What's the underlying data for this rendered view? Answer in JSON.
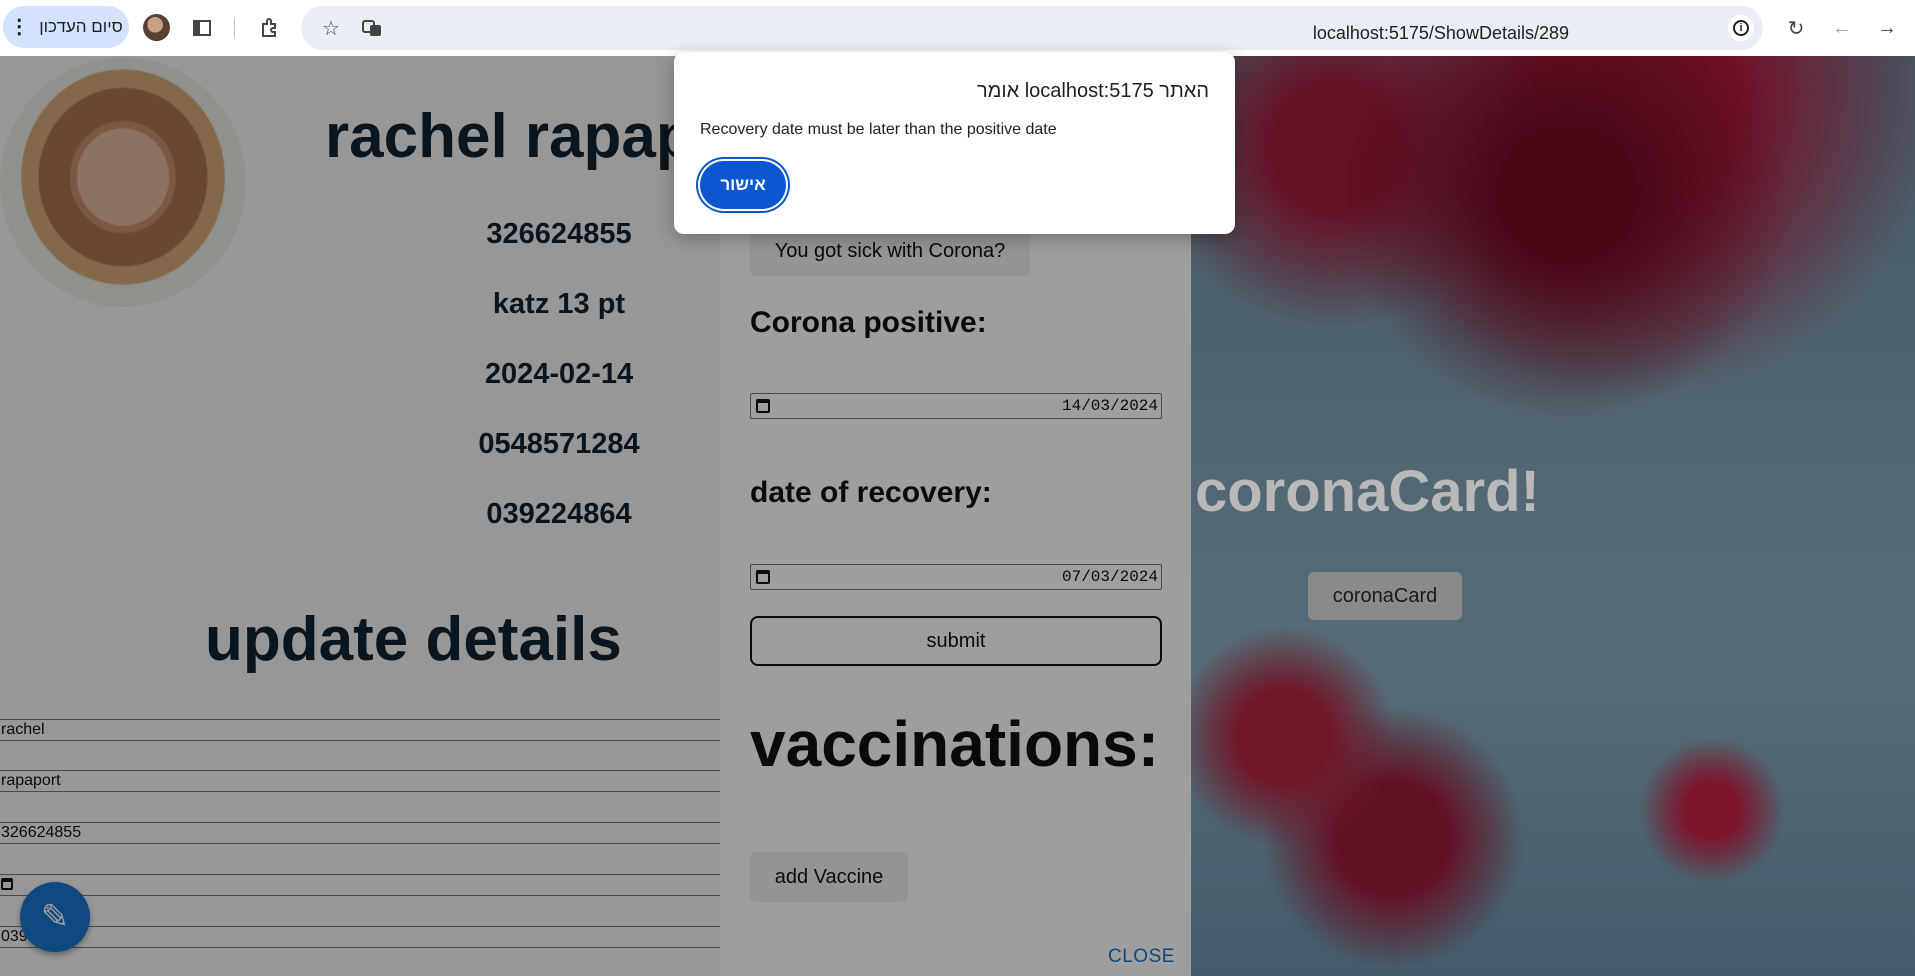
{
  "browser": {
    "update_button_label": "סיום העדכון",
    "url": "localhost:5175/ShowDetails/289",
    "icons": [
      "kebab-menu-icon",
      "profile-avatar",
      "side-panel-icon",
      "extensions-icon",
      "bookmark-star-icon",
      "translate-icon",
      "site-info-icon",
      "reload-icon",
      "back-icon",
      "forward-icon"
    ]
  },
  "person": {
    "name": "rachel rapaport",
    "id_number": "326624855",
    "address": "katz 13 pt",
    "date": "2024-02-14",
    "mobile": "0548571284",
    "phone": "039224864"
  },
  "update": {
    "title": "update details",
    "rows": [
      "rachel",
      "rapaport",
      "326624855",
      "",
      "039"
    ]
  },
  "corona_panel": {
    "sick_button": "You got sick with Corona?",
    "positive_label": "Corona positive:",
    "positive_date": "14/03/2024",
    "recovery_label": "date of recovery:",
    "recovery_date": "07/03/2024",
    "submit_label": "submit",
    "vaccinations_title": "vaccinations:",
    "add_vaccine_label": "add Vaccine",
    "close_label": "CLOSE"
  },
  "background": {
    "title": "coronaCard!",
    "button_label": "coronaCard"
  },
  "alert": {
    "title": "האתר localhost:5175 אומר",
    "message": "Recovery date must be later than the positive date",
    "ok_label": "אישור"
  },
  "colors": {
    "accent_blue": "#0b57d0",
    "fab_blue": "#1976d2",
    "heading_navy": "#102333"
  }
}
